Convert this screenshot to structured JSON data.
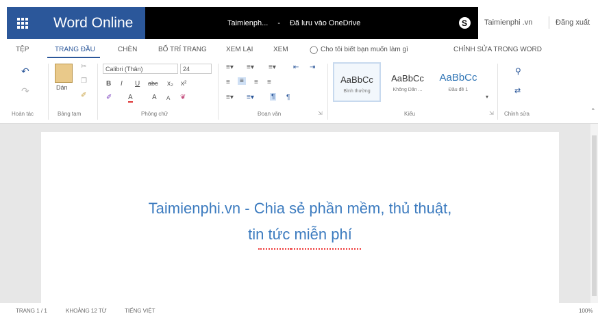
{
  "title_bar": {
    "app_name": "Word Online",
    "doc_title": "Taimienph...",
    "separator": "-",
    "save_status": "Đã lưu vào OneDrive",
    "skype_glyph": "S",
    "user": "Taimienphi .vn",
    "sign_out": "Đăng xuất"
  },
  "tabs": [
    {
      "label": "TỆP"
    },
    {
      "label": "TRANG ĐẦU"
    },
    {
      "label": "CHÈN"
    },
    {
      "label": "BỐ TRÍ TRANG"
    },
    {
      "label": "XEM LẠI"
    },
    {
      "label": "XEM"
    },
    {
      "label": "Cho tôi biết bạn muốn làm gì"
    },
    {
      "label": "CHỈNH SỬA TRONG WORD"
    }
  ],
  "ribbon": {
    "undo_label": "Hoàn tác",
    "paste_label": "Dán",
    "clipboard_label": "Bảng tạm",
    "font_name": "Calibri (Thân)",
    "font_size": "24",
    "bold": "B",
    "italic": "I",
    "underline": "U",
    "strike": "abc",
    "subscript": "x₂",
    "superscript": "x²",
    "font_color": "A",
    "grow": "A",
    "shrink": "A",
    "font_group_label": "Phông chữ",
    "paragraph_label": "Đoạn văn",
    "styles": [
      {
        "preview": "AaBbCc",
        "name": "Bình thường"
      },
      {
        "preview": "AaBbCc",
        "name": "Không Dãn ..."
      },
      {
        "preview": "AaBbCc",
        "name": "Đầu đề 1"
      }
    ],
    "styles_label": "Kiểu",
    "editing_label": "Chỉnh sửa"
  },
  "document": {
    "line1": "Taimienphi.vn - Chia sẻ phần mềm, thủ thuật,",
    "line2": "tin tức miễn phí"
  },
  "status_bar": {
    "page": "TRANG 1 / 1",
    "words": "KHOẢNG 12 TỪ",
    "language": "TIẾNG VIỆT",
    "zoom": "100%"
  },
  "colors": {
    "brand_blue": "#2b579a",
    "doc_text": "#3c7bbf"
  }
}
